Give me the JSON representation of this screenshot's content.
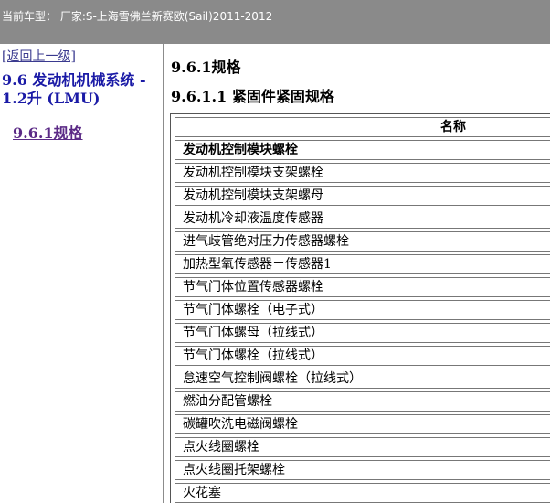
{
  "topbar": {
    "vehicle_info": "当前车型： 厂家:S-上海雪佛兰新赛欧(Sail)2011-2012"
  },
  "nav": {
    "back_label": "[返回上一级]",
    "section_title": "9.6 发动机机械系统 - 1.2升 (LMU)",
    "current_link": "9.6.1规格"
  },
  "content": {
    "heading": "9.6.1规格",
    "subheading": "9.6.1.1 紧固件紧固规格",
    "table": {
      "header": "名称",
      "rows": [
        "发动机控制模块螺栓",
        "发动机控制模块支架螺栓",
        "发动机控制模块支架螺母",
        "发动机冷却液温度传感器",
        "进气歧管绝对压力传感器螺栓",
        "加热型氧传感器－传感器1",
        "节气门体位置传感器螺栓",
        "节气门体螺栓（电子式）",
        "节气门体螺母（拉线式）",
        "节气门体螺栓（拉线式）",
        "怠速空气控制阀螺栓（拉线式）",
        "燃油分配管螺栓",
        "碳罐吹洗电磁阀螺栓",
        "点火线圈螺栓",
        "点火线圈托架螺栓",
        "火花塞"
      ]
    }
  }
}
